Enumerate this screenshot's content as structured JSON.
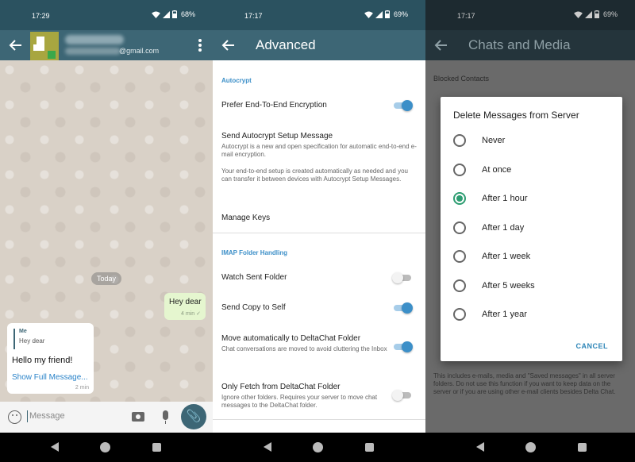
{
  "panel1": {
    "status": {
      "time": "17:29",
      "battery": "68%"
    },
    "header": {
      "subtitle": "@gmail.com"
    },
    "date_chip": "Today",
    "outgoing": {
      "text": "Hey dear",
      "time": "4 min"
    },
    "incoming": {
      "quote_name": "Me",
      "quote_text": "Hey dear",
      "body": "Hello my friend!",
      "link": "Show Full Message...",
      "time": "2 min"
    },
    "composer": {
      "placeholder": "Message"
    }
  },
  "panel2": {
    "status": {
      "time": "17:17",
      "battery": "69%"
    },
    "title": "Advanced",
    "autocrypt_header": "Autocrypt",
    "prefer_e2e": "Prefer End-To-End Encryption",
    "send_setup_title": "Send Autocrypt Setup Message",
    "send_setup_summary": "Autocrypt is a new and open specification for automatic end-to-end e-mail encryption.",
    "send_setup_summary2": "Your end-to-end setup is created automatically as needed and you can transfer it between devices with Autocrypt Setup Messages.",
    "manage_keys": "Manage Keys",
    "imap_header": "IMAP Folder Handling",
    "watch_sent": "Watch Sent Folder",
    "send_copy": "Send Copy to Self",
    "move_auto_title": "Move automatically to DeltaChat Folder",
    "move_auto_summary": "Chat conversations are moved to avoid cluttering the Inbox",
    "only_fetch_title": "Only Fetch from DeltaChat Folder",
    "only_fetch_summary": "Ignore other folders. Requires your server to move chat messages to the DeltaChat folder."
  },
  "panel3": {
    "status": {
      "time": "17:17",
      "battery": "69%"
    },
    "title": "Chats and Media",
    "blocked_contacts": "Blocked Contacts",
    "bottom_text": "This includes e-mails, media and \"Saved messages\" in all server folders. Do not use this function if you want to keep data on the server or if you are using other e-mail clients besides Delta Chat.",
    "dialog": {
      "title": "Delete Messages from Server",
      "options": [
        "Never",
        "At once",
        "After 1 hour",
        "After 1 day",
        "After 1 week",
        "After 5 weeks",
        "After 1 year"
      ],
      "selected_index": 2,
      "cancel": "CANCEL"
    }
  }
}
